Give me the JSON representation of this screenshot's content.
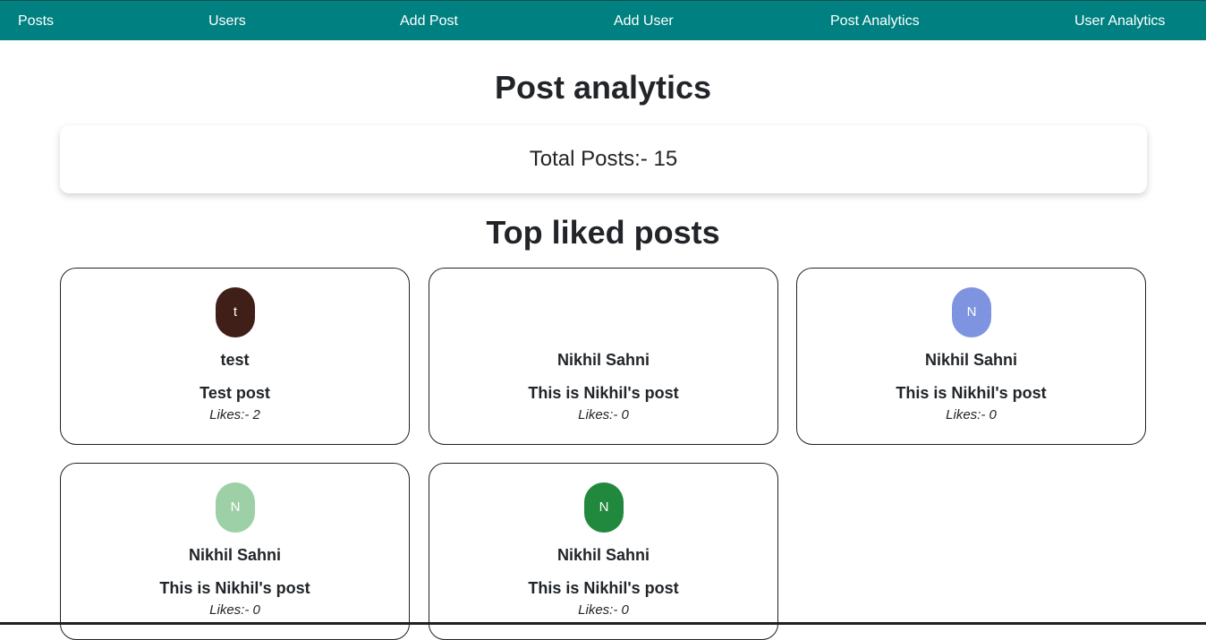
{
  "nav": {
    "posts": "Posts",
    "users": "Users",
    "add_post": "Add Post",
    "add_user": "Add User",
    "post_analytics": "Post Analytics",
    "user_analytics": "User Analytics"
  },
  "main": {
    "title": "Post analytics",
    "total_posts": "Total Posts:- 15",
    "top_liked_title": "Top liked posts"
  },
  "colors": {
    "navbar": "#008080",
    "avatar_1": "#3f1f17",
    "avatar_3": "#7f94e0",
    "avatar_4": "#9dd0a6",
    "avatar_5": "#21893d"
  },
  "posts": [
    {
      "avatar_initial": "t",
      "author": "test",
      "title": "Test post",
      "likes": "Likes:- 2"
    },
    {
      "avatar_initial": "",
      "author": "Nikhil Sahni",
      "title": "This is Nikhil's post",
      "likes": "Likes:- 0"
    },
    {
      "avatar_initial": "N",
      "author": "Nikhil Sahni",
      "title": "This is Nikhil's post",
      "likes": "Likes:- 0"
    },
    {
      "avatar_initial": "N",
      "author": "Nikhil Sahni",
      "title": "This is Nikhil's post",
      "likes": "Likes:- 0"
    },
    {
      "avatar_initial": "N",
      "author": "Nikhil Sahni",
      "title": "This is Nikhil's post",
      "likes": "Likes:- 0"
    }
  ]
}
